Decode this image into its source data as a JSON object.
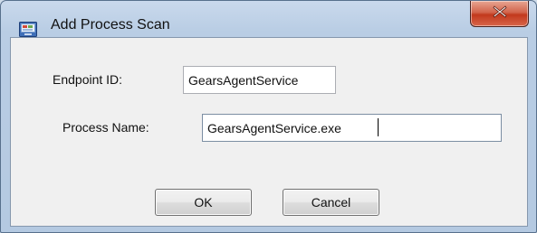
{
  "window": {
    "title": "Add Process Scan",
    "icon": "process-scan-app-icon",
    "close_icon": "close-x-icon"
  },
  "form": {
    "endpoint_id": {
      "label": "Endpoint ID:",
      "value": "GearsAgentService"
    },
    "process_name": {
      "label": "Process Name:",
      "value": "GearsAgentService.exe"
    }
  },
  "buttons": {
    "ok": "OK",
    "cancel": "Cancel"
  },
  "colors": {
    "close_button": "#c7412a",
    "title_bar": "#b9cde4",
    "client_area": "#f0f0f0"
  }
}
